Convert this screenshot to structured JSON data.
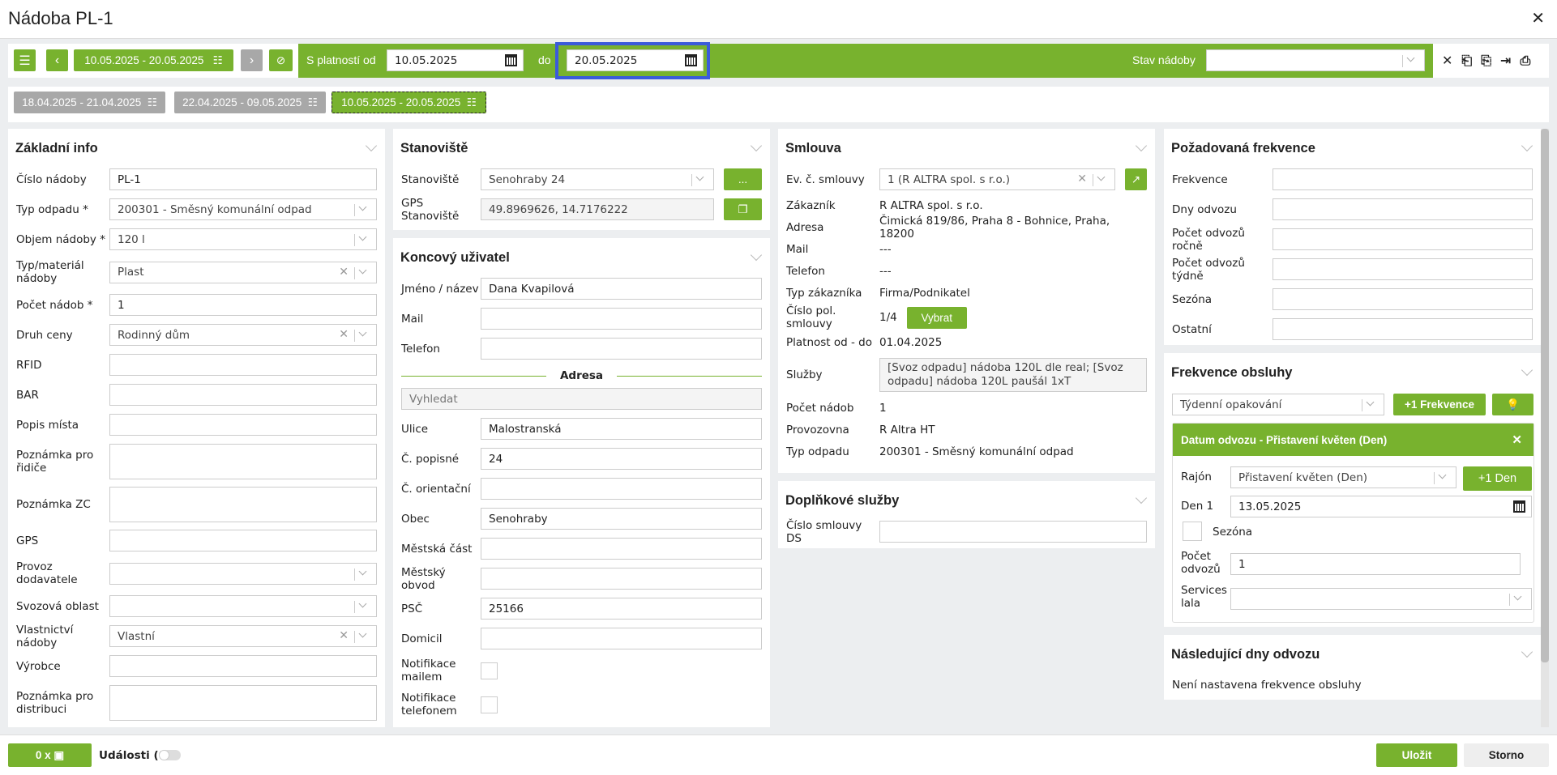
{
  "title": "Nádoba PL-1",
  "toolbar": {
    "period": "10.05.2025 - 20.05.2025",
    "valid_from_label": "S platností od",
    "valid_from": "10.05.2025",
    "to_label": "do",
    "valid_to": "20.05.2025",
    "state_label": "Stav nádoby",
    "state_value": ""
  },
  "tabs": [
    "18.04.2025 - 21.04.2025",
    "22.04.2025 - 09.05.2025",
    "10.05.2025 - 20.05.2025"
  ],
  "zakladni": {
    "title": "Základní info",
    "rows": [
      {
        "label": "Číslo nádoby",
        "type": "text",
        "value": "PL-1"
      },
      {
        "label": "Typ odpadu *",
        "type": "select",
        "value": "200301 - Směsný komunální odpad"
      },
      {
        "label": "Objem nádoby *",
        "type": "select",
        "value": "120 l"
      },
      {
        "label": "Typ/materiál nádoby",
        "type": "select",
        "value": "Plast",
        "clear": true,
        "h": 36
      },
      {
        "label": "Počet nádob *",
        "type": "text",
        "value": "1"
      },
      {
        "label": "Druh ceny",
        "type": "select",
        "value": "Rodinný dům",
        "clear": true
      },
      {
        "label": "RFID",
        "type": "text",
        "value": ""
      },
      {
        "label": "BAR",
        "type": "text",
        "value": ""
      },
      {
        "label": "Popis místa",
        "type": "text",
        "value": ""
      },
      {
        "label": "Poznámka pro řidiče",
        "type": "ta",
        "value": ""
      },
      {
        "label": "Poznámka ZC",
        "type": "ta",
        "value": ""
      },
      {
        "label": "GPS",
        "type": "text",
        "value": ""
      },
      {
        "label": "Provoz dodavatele",
        "type": "select",
        "value": "",
        "h": 36
      },
      {
        "label": "Svozová oblast",
        "type": "select",
        "value": ""
      },
      {
        "label": "Vlastnictví nádoby",
        "type": "select",
        "value": "Vlastní",
        "clear": true
      },
      {
        "label": "Výrobce",
        "type": "text",
        "value": ""
      },
      {
        "label": "Poznámka pro distribuci",
        "type": "ta",
        "value": ""
      }
    ]
  },
  "stanoviste": {
    "title": "Stanoviště",
    "rows": [
      {
        "label": "Stanoviště",
        "type": "select",
        "value": "Senohraby 24",
        "btn": "..."
      },
      {
        "label": "GPS Stanoviště",
        "type": "ro",
        "value": "49.8969626, 14.7176222",
        "btn": "copy"
      }
    ]
  },
  "koncovy": {
    "title": "Koncový uživatel",
    "rows": [
      {
        "label": "Jméno / název",
        "type": "text",
        "value": "Dana Kvapilová"
      },
      {
        "label": "Mail",
        "type": "text",
        "value": ""
      },
      {
        "label": "Telefon",
        "type": "text",
        "value": ""
      }
    ],
    "address_label": "Adresa",
    "search_placeholder": "Vyhledat",
    "rows2": [
      {
        "label": "Ulice",
        "type": "text",
        "value": "Malostranská"
      },
      {
        "label": "Č. popisné",
        "type": "text",
        "value": "24"
      },
      {
        "label": "Č. orientační",
        "type": "text",
        "value": ""
      },
      {
        "label": "Obec",
        "type": "text",
        "value": "Senohraby"
      },
      {
        "label": "Městská část",
        "type": "text",
        "value": ""
      },
      {
        "label": "Městský obvod",
        "type": "text",
        "value": ""
      },
      {
        "label": "PSČ",
        "type": "text",
        "value": "25166"
      },
      {
        "label": "Domicil",
        "type": "text",
        "value": ""
      },
      {
        "label": "Notifikace mailem",
        "type": "chk",
        "h": 34
      },
      {
        "label": "Notifikace telefonem",
        "type": "chk",
        "h": 34
      }
    ]
  },
  "smlouva": {
    "title": "Smlouva",
    "rows": [
      {
        "label": "Ev. č. smlouvy",
        "type": "select",
        "value": "1 (R ALTRA spol. s r.o.)",
        "clear": true,
        "btn": "open"
      },
      {
        "label": "Zákazník",
        "type": "static",
        "value": "R ALTRA spol. s r.o.",
        "h": 22
      },
      {
        "label": "Adresa",
        "type": "static",
        "value": "Čimická 819/86, Praha 8 - Bohnice, Praha, 18200",
        "h": 22
      },
      {
        "label": "Mail",
        "type": "static",
        "value": "---",
        "h": 22
      },
      {
        "label": "Telefon",
        "type": "static",
        "value": "---",
        "h": 22
      },
      {
        "label": "Typ zákazníka",
        "type": "static",
        "value": "Firma/Podnikatel",
        "h": 22
      },
      {
        "label": "Číslo pol. smlouvy",
        "type": "static",
        "value": "1/4",
        "btn2": "Vybrat",
        "h": 28
      },
      {
        "label": "Platnost od - do",
        "type": "static",
        "value": "01.04.2025",
        "h": 22
      },
      {
        "label": "Služby",
        "type": "area",
        "value": "[Svoz odpadu] nádoba 120L dle real; [Svoz odpadu] nádoba 120L paušál 1xT",
        "h": 44
      },
      {
        "label": "Počet nádob",
        "type": "static",
        "value": "1",
        "h": 22
      },
      {
        "label": "Provozovna",
        "type": "static",
        "value": "R Altra HT",
        "h": 22
      },
      {
        "label": "Typ odpadu",
        "type": "static",
        "value": "200301 - Směsný komunální odpad",
        "h": 22
      }
    ]
  },
  "doplnkove": {
    "title": "Doplňkové služby",
    "rows": [
      {
        "label": "Číslo smlouvy DS",
        "type": "text",
        "value": ""
      }
    ]
  },
  "pozadovana": {
    "title": "Požadovaná frekvence",
    "rows": [
      {
        "label": "Frekvence",
        "type": "text",
        "value": ""
      },
      {
        "label": "Dny odvozu",
        "type": "text",
        "value": ""
      },
      {
        "label": "Počet odvozů ročně",
        "type": "text",
        "value": ""
      },
      {
        "label": "Počet odvozů týdně",
        "type": "text",
        "value": ""
      },
      {
        "label": "Sezóna",
        "type": "text",
        "value": ""
      },
      {
        "label": "Ostatní",
        "type": "text",
        "value": ""
      }
    ]
  },
  "frekvence": {
    "title": "Frekvence obsluhy",
    "repeat": "Týdenní opakování",
    "add_label": "+1 Frekvence",
    "card_title": "Datum odvozu - Přistavení květen (Den)",
    "rajon_label": "Rajón",
    "rajon": "Přistavení květen (Den)",
    "add_day": "+1 Den",
    "day_label": "Den 1",
    "day": "13.05.2025",
    "season_label": "Sezóna",
    "count_label": "Počet odvozů",
    "count": "1",
    "services_label": "Services lala"
  },
  "nasledujici": {
    "title": "Následující dny odvozu",
    "text": "Není nastavena frekvence obsluhy"
  },
  "footer": {
    "photos": "0 x",
    "events": "Události (0)",
    "save": "Uložit",
    "cancel": "Storno"
  },
  "colors": {
    "green": "#78b22e",
    "highlight": "#3b5bdb"
  }
}
